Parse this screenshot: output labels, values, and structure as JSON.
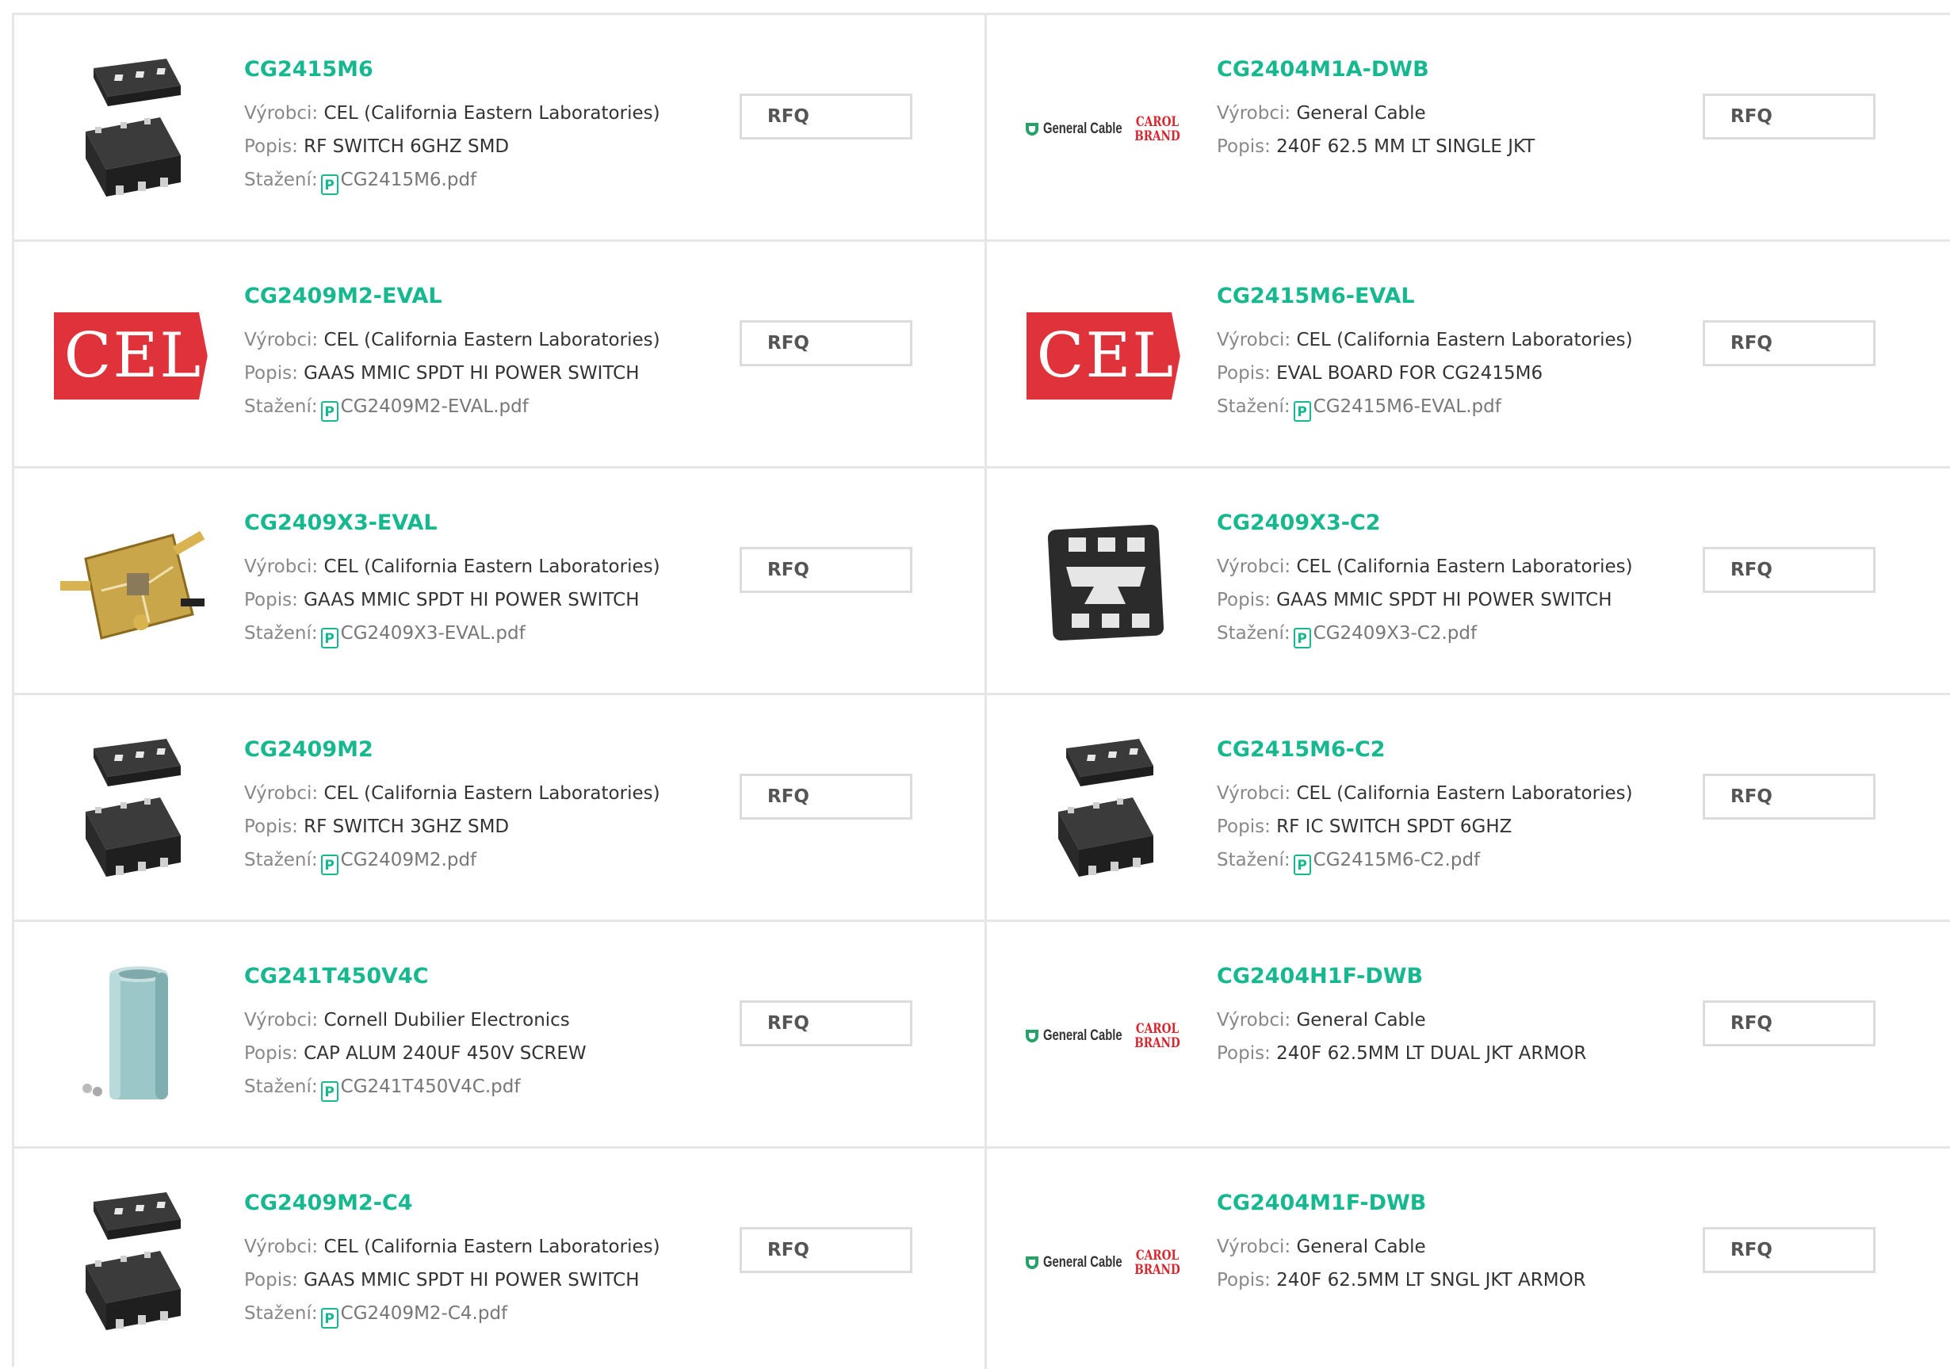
{
  "labels": {
    "maker": "Výrobci:",
    "desc": "Popis:",
    "download": "Stažení:",
    "rfq": "RFQ",
    "pdf_icon_glyph": "P"
  },
  "colors": {
    "accent": "#17b890",
    "cel_red": "#e0323a",
    "border": "#e6e6e6"
  },
  "brand_logos": {
    "cel_text": "CEL",
    "gc_text": "General Cable",
    "carol_line1": "CAROL",
    "carol_line2": "BRAND"
  },
  "products": [
    {
      "pn": "CG2415M6",
      "maker": "CEL (California Eastern Laboratories)",
      "desc": "RF SWITCH 6GHZ SMD",
      "pdf": "CG2415M6.pdf",
      "image": "ic-package-icon"
    },
    {
      "pn": "CG2404M1A-DWB",
      "maker": "General Cable",
      "desc": "240F 62.5 MM LT SINGLE JKT",
      "pdf": "",
      "image": "general-cable-logo"
    },
    {
      "pn": "CG2409M2-EVAL",
      "maker": "CEL (California Eastern Laboratories)",
      "desc": "GAAS MMIC SPDT HI POWER SWITCH",
      "pdf": "CG2409M2-EVAL.pdf",
      "image": "cel-logo"
    },
    {
      "pn": "CG2415M6-EVAL",
      "maker": "CEL (California Eastern Laboratories)",
      "desc": "EVAL BOARD FOR CG2415M6",
      "pdf": "CG2415M6-EVAL.pdf",
      "image": "cel-logo"
    },
    {
      "pn": "CG2409X3-EVAL",
      "maker": "CEL (California Eastern Laboratories)",
      "desc": "GAAS MMIC SPDT HI POWER SWITCH",
      "pdf": "CG2409X3-EVAL.pdf",
      "image": "eval-board-icon"
    },
    {
      "pn": "CG2409X3-C2",
      "maker": "CEL (California Eastern Laboratories)",
      "desc": "GAAS MMIC SPDT HI POWER SWITCH",
      "pdf": "CG2409X3-C2.pdf",
      "image": "qfn-chip-icon"
    },
    {
      "pn": "CG2409M2",
      "maker": "CEL (California Eastern Laboratories)",
      "desc": "RF SWITCH 3GHZ SMD",
      "pdf": "CG2409M2.pdf",
      "image": "ic-package-icon"
    },
    {
      "pn": "CG2415M6-C2",
      "maker": "CEL (California Eastern Laboratories)",
      "desc": "RF IC SWITCH SPDT 6GHZ",
      "pdf": "CG2415M6-C2.pdf",
      "image": "ic-package-icon"
    },
    {
      "pn": "CG241T450V4C",
      "maker": "Cornell Dubilier Electronics",
      "desc": "CAP ALUM 240UF 450V SCREW",
      "pdf": "CG241T450V4C.pdf",
      "image": "capacitor-icon"
    },
    {
      "pn": "CG2404H1F-DWB",
      "maker": "General Cable",
      "desc": "240F 62.5MM LT DUAL JKT ARMOR",
      "pdf": "",
      "image": "general-cable-logo"
    },
    {
      "pn": "CG2409M2-C4",
      "maker": "CEL (California Eastern Laboratories)",
      "desc": "GAAS MMIC SPDT HI POWER SWITCH",
      "pdf": "CG2409M2-C4.pdf",
      "image": "ic-package-icon"
    },
    {
      "pn": "CG2404M1F-DWB",
      "maker": "General Cable",
      "desc": "240F 62.5MM LT SNGL JKT ARMOR",
      "pdf": "",
      "image": "general-cable-logo"
    }
  ]
}
